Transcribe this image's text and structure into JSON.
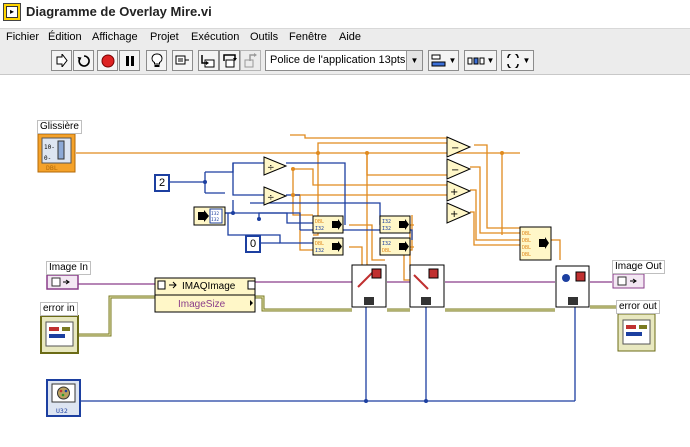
{
  "window": {
    "title": "Diagramme de Overlay Mire.vi",
    "icon": "labview-vi-icon"
  },
  "menu": [
    {
      "label": "Fichier"
    },
    {
      "label": "Édition"
    },
    {
      "label": "Affichage"
    },
    {
      "label": "Projet"
    },
    {
      "label": "Exécution"
    },
    {
      "label": "Outils"
    },
    {
      "label": "Fenêtre"
    },
    {
      "label": "Aide"
    }
  ],
  "toolbar": {
    "buttons": [
      "run-arrow-icon",
      "run-continuously-icon",
      "abort-icon",
      "pause-icon",
      "highlight-execution-icon",
      "retain-wire-values-icon",
      "step-into-icon",
      "step-over-icon",
      "step-out-icon"
    ],
    "font_select": "Police de l'application 13pts",
    "align_icon": "align-objects-icon",
    "distribute_icon": "distribute-objects-icon",
    "reorder_icon": "reorder-icon"
  },
  "diagram": {
    "labels": {
      "slider": "Glissière",
      "image_in": "Image In",
      "error_in": "error in",
      "image_out": "Image Out",
      "error_out": "error out"
    },
    "constants": {
      "two": "2",
      "zero": "0"
    },
    "terminal_types": {
      "slider": "DBL",
      "u32": "U32",
      "dbl": "DBL",
      "i32": "I32"
    },
    "property_node": {
      "class": "IMAQImage",
      "property": "ImageSize"
    },
    "colors": {
      "wire_orange": "#e08a1e",
      "wire_blue": "#1c3fa0",
      "wire_error": "#7a7a22",
      "wire_image": "#8a3d8a",
      "node_border": "#000000"
    }
  }
}
